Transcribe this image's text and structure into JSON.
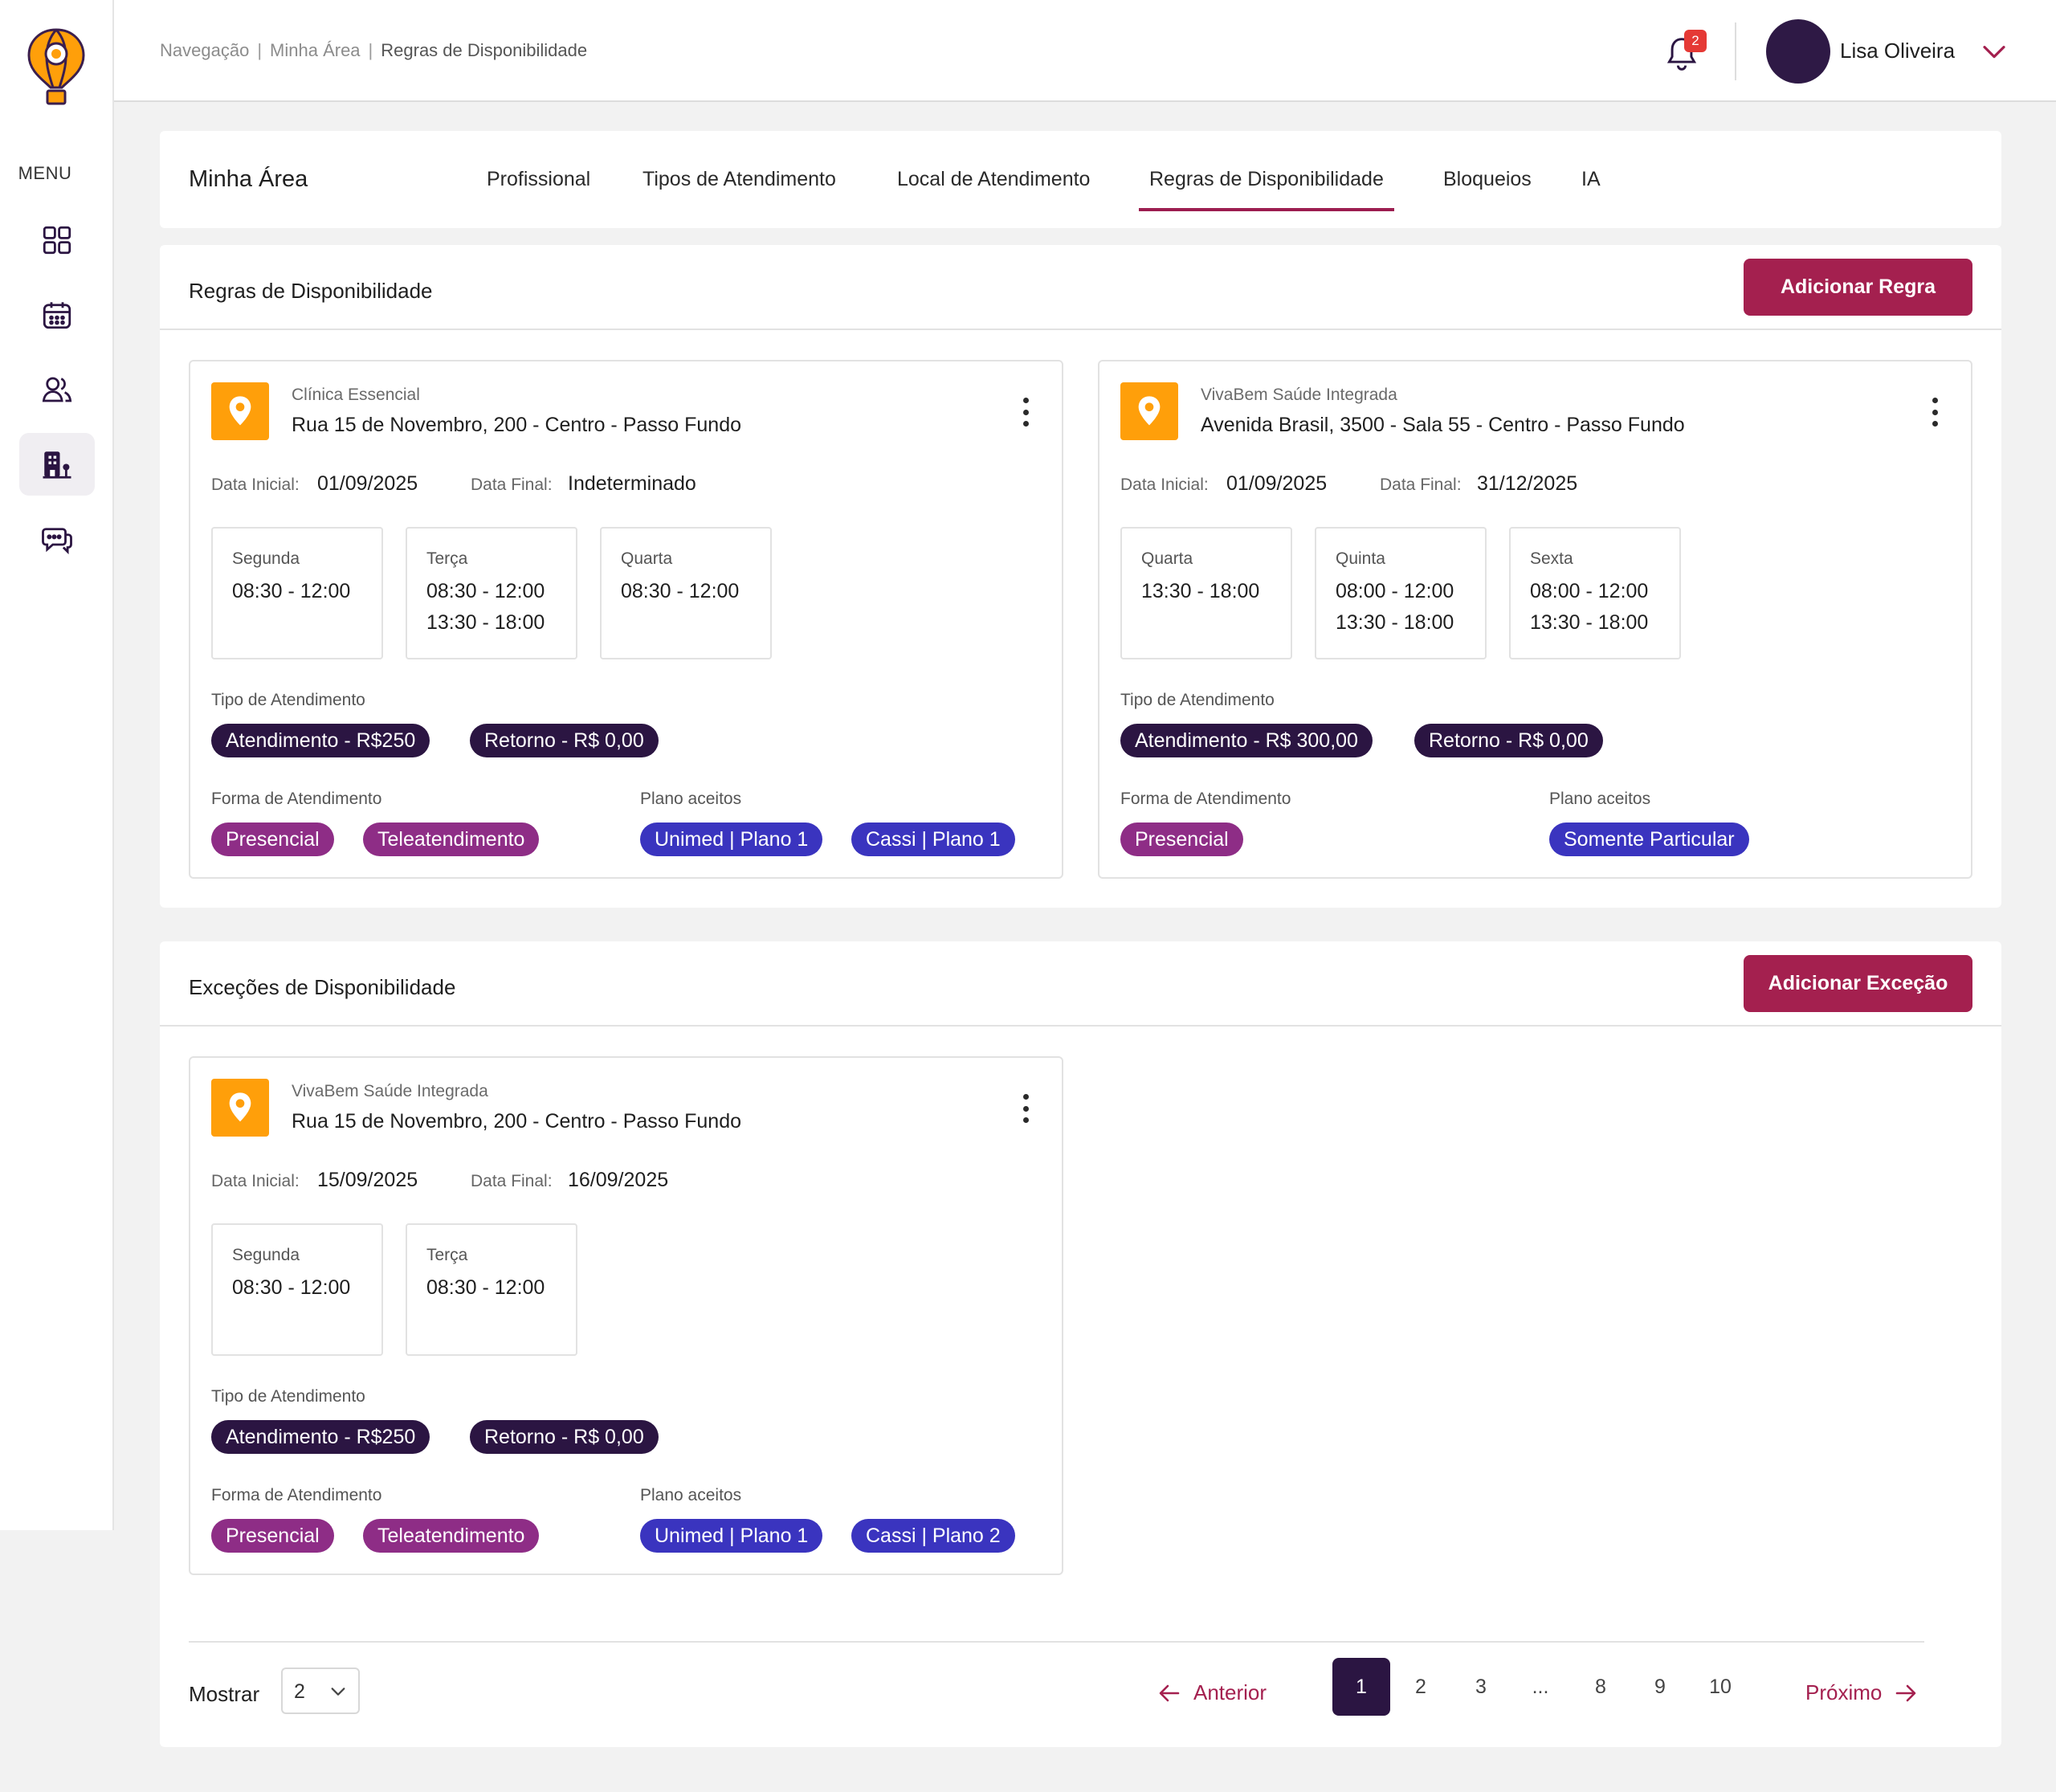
{
  "sidebar": {
    "menu_label": "MENU",
    "items": [
      {
        "name": "dashboard-icon",
        "active": false
      },
      {
        "name": "calendar-icon",
        "active": false
      },
      {
        "name": "users-icon",
        "active": false
      },
      {
        "name": "building-icon",
        "active": true
      },
      {
        "name": "chat-icon",
        "active": false
      }
    ]
  },
  "topbar": {
    "breadcrumb": [
      "Navegação",
      "Minha Área",
      "Regras de Disponibilidade"
    ],
    "notifications_count": "2",
    "user_name": "Lisa Oliveira"
  },
  "tabs_panel": {
    "title": "Minha Área",
    "tabs": [
      "Profissional",
      "Tipos de Atendimento",
      "Local de Atendimento",
      "Regras de Disponibilidade",
      "Bloqueios",
      "IA"
    ],
    "active_tab": "Regras de Disponibilidade"
  },
  "rules_section": {
    "title": "Regras de Disponibilidade",
    "add_button": "Adicionar Regra",
    "cards": [
      {
        "clinic": "Clínica Essencial",
        "address": "Rua 15 de Novembro, 200 - Centro - Passo Fundo",
        "start_label": "Data Inicial:",
        "start_value": "01/09/2025",
        "end_label": "Data Final:",
        "end_value": "Indeterminado",
        "days": [
          {
            "name": "Segunda",
            "times": [
              "08:30 - 12:00"
            ]
          },
          {
            "name": "Terça",
            "times": [
              "08:30 - 12:00",
              "13:30 - 18:00"
            ]
          },
          {
            "name": "Quarta",
            "times": [
              "08:30 - 12:00"
            ]
          }
        ],
        "tipo_label": "Tipo de Atendimento",
        "tipos": [
          "Atendimento - R$250",
          "Retorno - R$ 0,00"
        ],
        "forma_label": "Forma de Atendimento",
        "formas": [
          "Presencial",
          "Teleatendimento"
        ],
        "plano_label": "Plano aceitos",
        "planos": [
          "Unimed | Plano 1",
          "Cassi | Plano 1"
        ]
      },
      {
        "clinic": "VivaBem Saúde Integrada",
        "address": "Avenida Brasil, 3500 - Sala 55 - Centro - Passo Fundo",
        "start_label": "Data Inicial:",
        "start_value": "01/09/2025",
        "end_label": "Data Final:",
        "end_value": "31/12/2025",
        "days": [
          {
            "name": "Quarta",
            "times": [
              "13:30 - 18:00"
            ]
          },
          {
            "name": "Quinta",
            "times": [
              "08:00 - 12:00",
              "13:30 - 18:00"
            ]
          },
          {
            "name": "Sexta",
            "times": [
              "08:00 - 12:00",
              "13:30 - 18:00"
            ]
          }
        ],
        "tipo_label": "Tipo de Atendimento",
        "tipos": [
          "Atendimento - R$ 300,00",
          "Retorno - R$ 0,00"
        ],
        "forma_label": "Forma de Atendimento",
        "formas": [
          "Presencial"
        ],
        "plano_label": "Plano aceitos",
        "planos": [
          "Somente Particular"
        ]
      }
    ]
  },
  "exceptions_section": {
    "title": "Exceções de Disponibilidade",
    "add_button": "Adicionar Exceção",
    "cards": [
      {
        "clinic": "VivaBem Saúde Integrada",
        "address": "Rua 15 de Novembro, 200 - Centro - Passo Fundo",
        "start_label": "Data Inicial:",
        "start_value": "15/09/2025",
        "end_label": "Data Final:",
        "end_value": "16/09/2025",
        "days": [
          {
            "name": "Segunda",
            "times": [
              "08:30 - 12:00"
            ]
          },
          {
            "name": "Terça",
            "times": [
              "08:30 - 12:00"
            ]
          }
        ],
        "tipo_label": "Tipo de Atendimento",
        "tipos": [
          "Atendimento - R$250",
          "Retorno - R$ 0,00"
        ],
        "forma_label": "Forma de Atendimento",
        "formas": [
          "Presencial",
          "Teleatendimento"
        ],
        "plano_label": "Plano aceitos",
        "planos": [
          "Unimed | Plano 1",
          "Cassi | Plano 2"
        ]
      }
    ]
  },
  "pagination": {
    "show_label": "Mostrar",
    "page_size": "2",
    "prev_label": "Anterior",
    "next_label": "Próximo",
    "pages": [
      "1",
      "2",
      "3",
      "...",
      "8",
      "9",
      "10"
    ],
    "current_page": "1"
  },
  "colors": {
    "primary": "#a4204f",
    "dark_purple": "#2b1542",
    "magenta": "#8e2d86",
    "blue": "#3a34bf",
    "pin_orange": "#ff9f0a"
  }
}
